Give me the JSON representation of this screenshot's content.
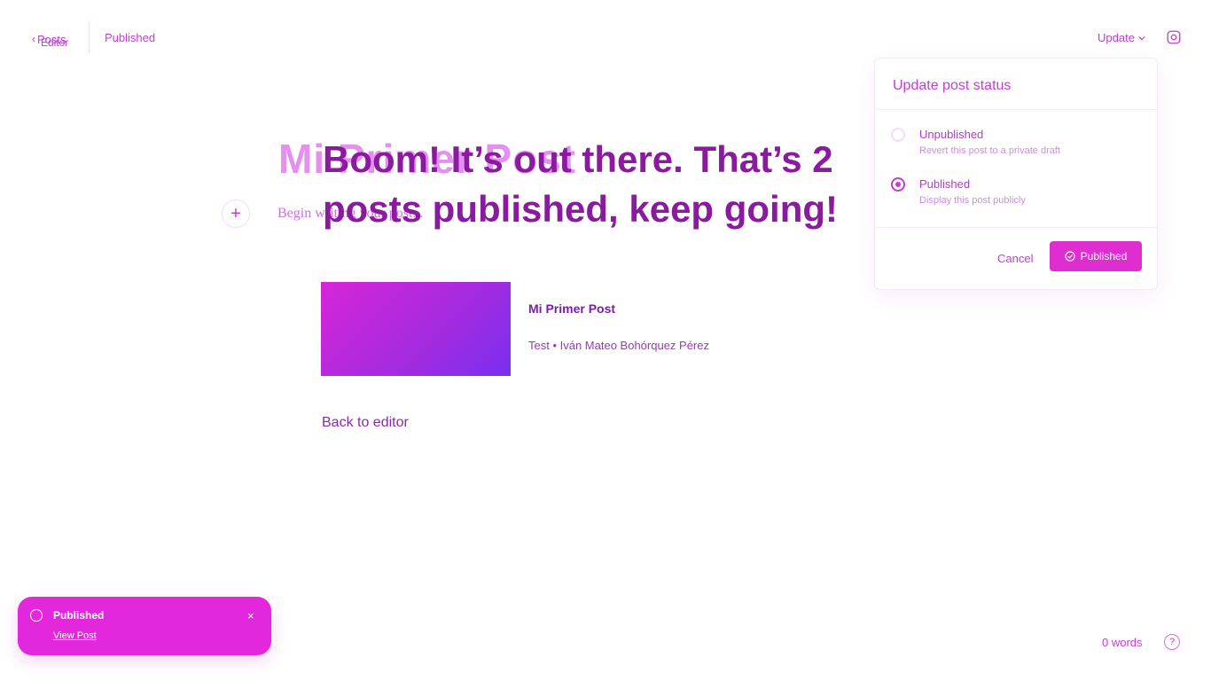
{
  "header": {
    "back_label": "Posts",
    "editor_label": "Editor",
    "post_status": "Published",
    "update_label": "Update"
  },
  "editor": {
    "title": "Mi Primer Post",
    "body_placeholder": "Begin writing your post..."
  },
  "success": {
    "heading": "Boom! It’s out there. That’s 2 posts published, keep going!",
    "post_title": "Mi Primer Post",
    "post_meta": "Test • Iván Mateo Bohórquez Pérez",
    "back_to_editor": "Back to editor"
  },
  "status_panel": {
    "title": "Update post status",
    "options": [
      {
        "label": "Unpublished",
        "description": "Revert this post to a private draft",
        "selected": false
      },
      {
        "label": "Published",
        "description": "Display this post publicly",
        "selected": true
      }
    ],
    "cancel_label": "Cancel",
    "confirm_label": "Published"
  },
  "toast": {
    "title": "Published",
    "link": "View Post"
  },
  "footer": {
    "word_count": "0 words",
    "help_label": "?"
  },
  "colors": {
    "accent": "#de2ed0",
    "text": "#7a1fa2",
    "muted": "#cf8ee0"
  }
}
